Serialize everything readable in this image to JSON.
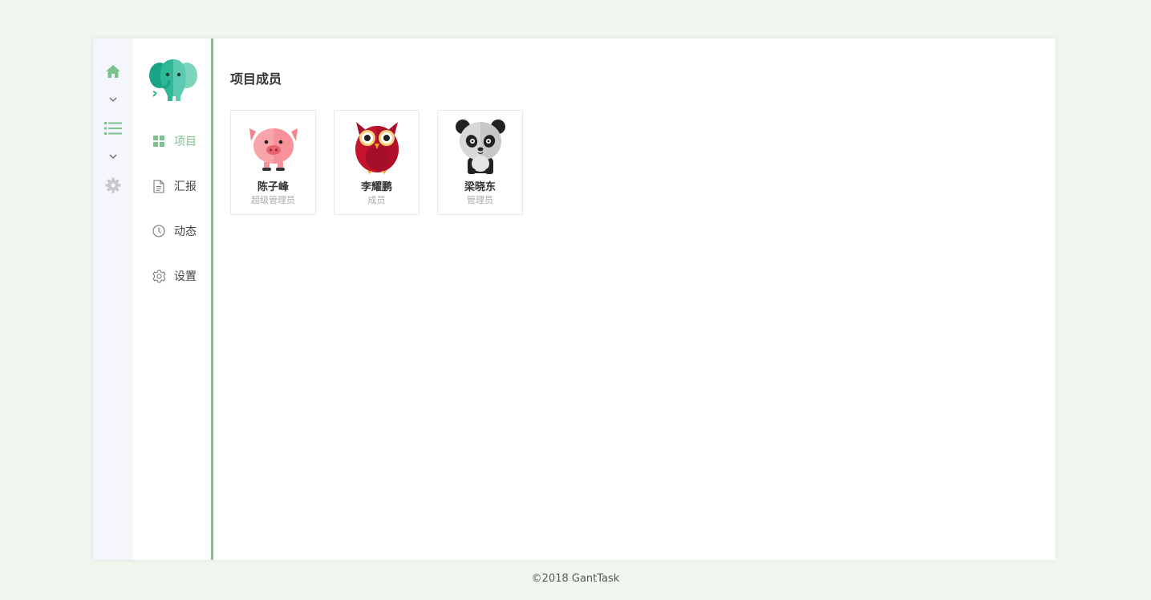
{
  "rail": {
    "items": [
      {
        "icon": "home-icon",
        "color": "#7cc28f"
      },
      {
        "icon": "chevron-down-icon"
      },
      {
        "icon": "list-icon",
        "color": "#7cc28f"
      },
      {
        "icon": "chevron-down-icon"
      },
      {
        "icon": "gear-icon",
        "color": "#c6c7cc"
      }
    ]
  },
  "sidenav": {
    "logo_icon": "elephant-logo-icon",
    "items": [
      {
        "label": "项目",
        "icon": "grid-icon",
        "active": true
      },
      {
        "label": "汇报",
        "icon": "document-icon",
        "active": false
      },
      {
        "label": "动态",
        "icon": "clock-icon",
        "active": false
      },
      {
        "label": "设置",
        "icon": "settings-icon",
        "active": false
      }
    ]
  },
  "main": {
    "title": "项目成员",
    "members": [
      {
        "name": "陈子峰",
        "role": "超级管理员",
        "avatar": "pig-avatar-icon"
      },
      {
        "name": "李耀鹏",
        "role": "成员",
        "avatar": "owl-avatar-icon"
      },
      {
        "name": "梁晓东",
        "role": "管理员",
        "avatar": "panda-avatar-icon"
      }
    ]
  },
  "footer": {
    "text": "©2018 GantTask"
  },
  "colors": {
    "accent": "#7cc28f",
    "background": "#f1f7ee",
    "rail": "#f5f6fb"
  }
}
